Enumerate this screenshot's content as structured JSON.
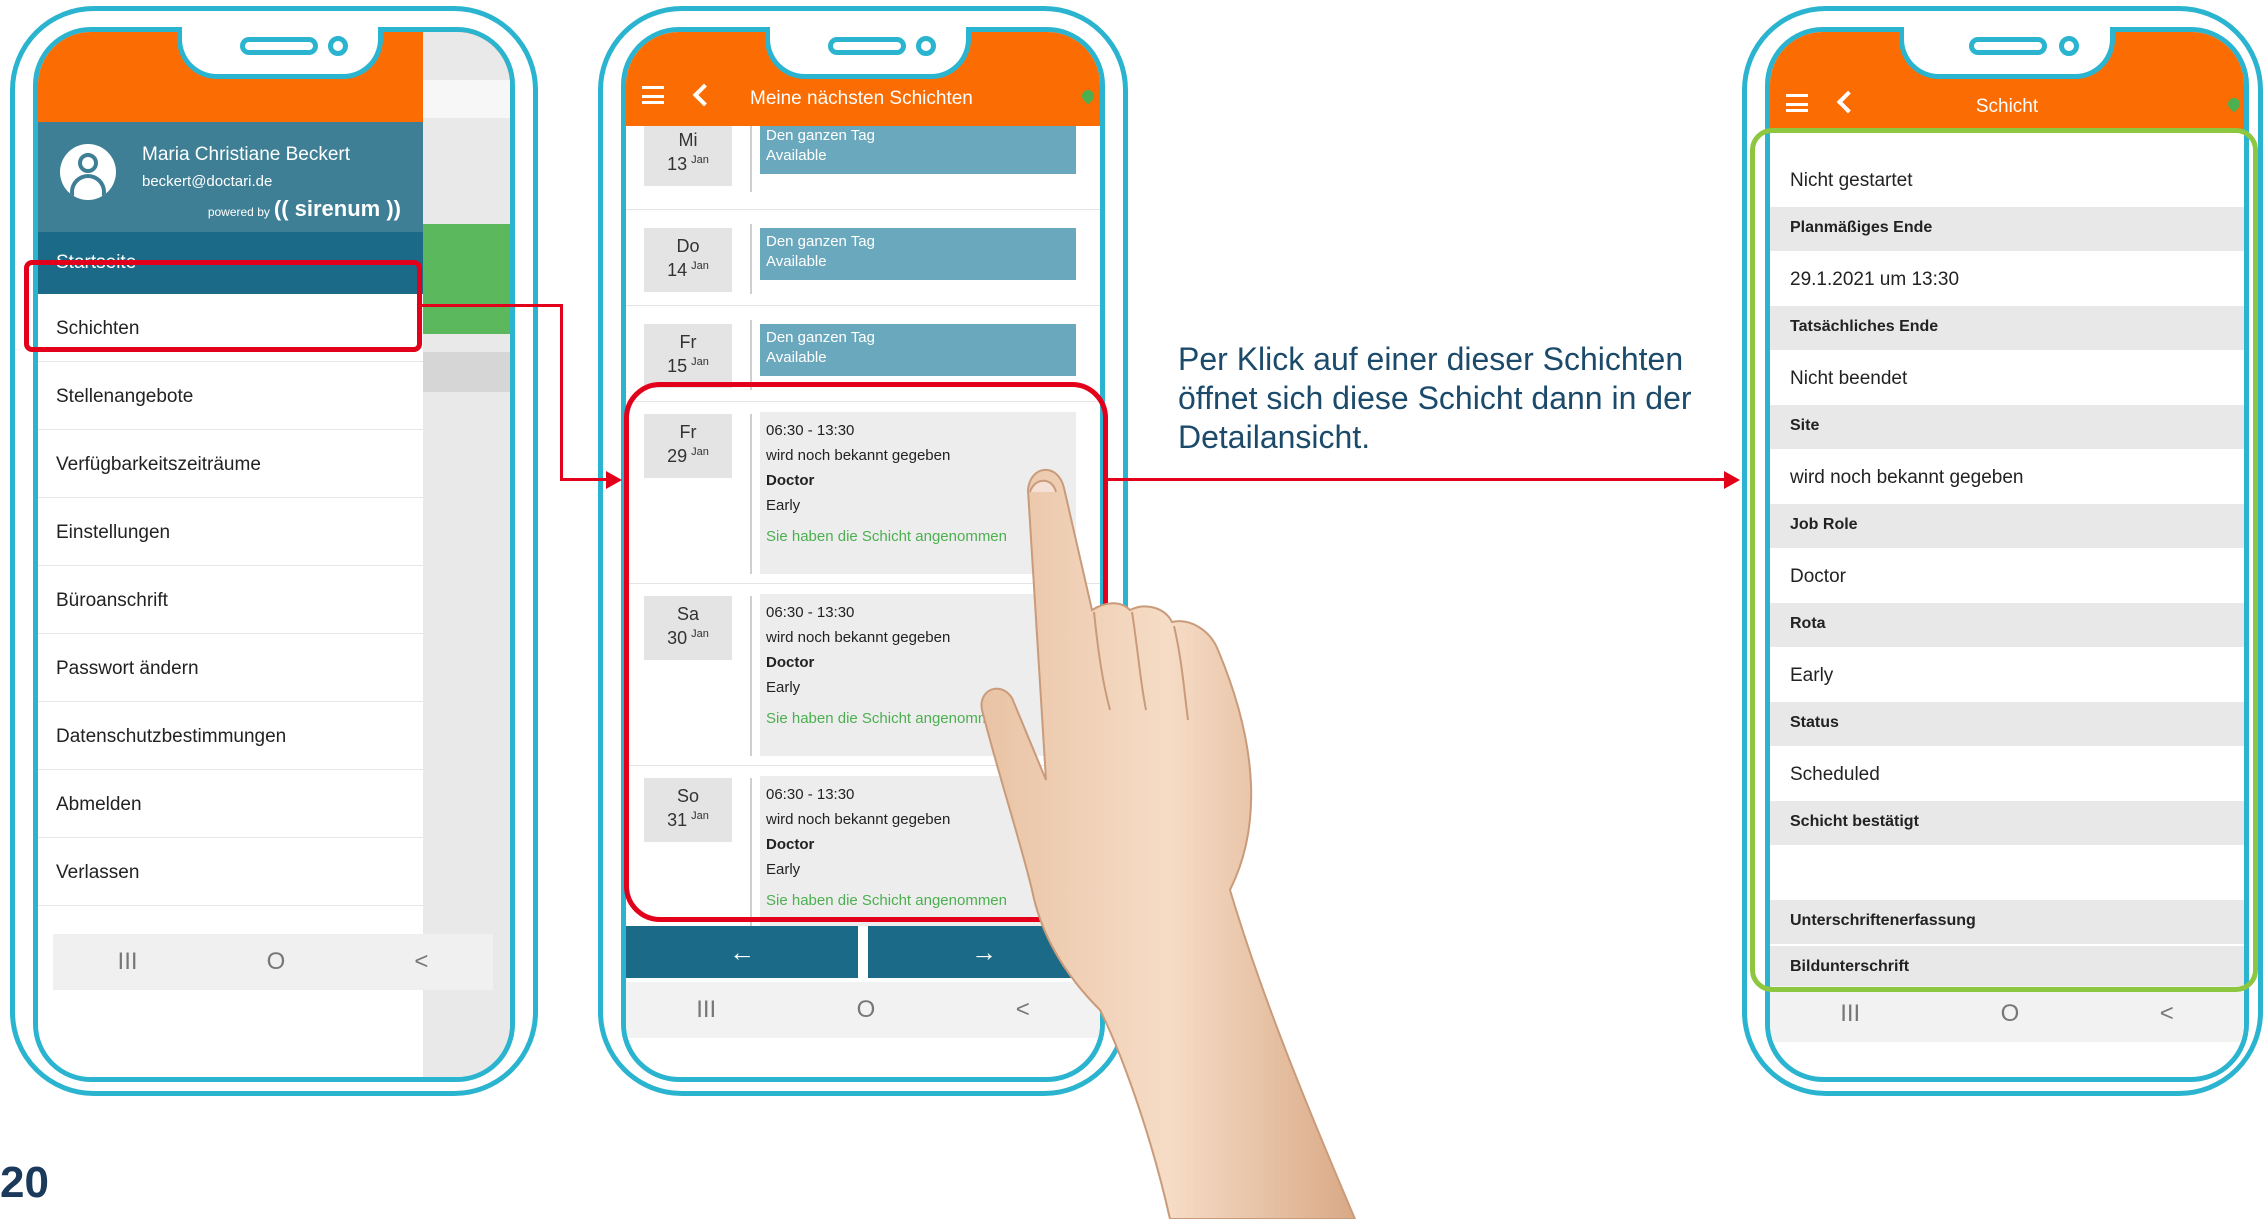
{
  "phone1": {
    "user_name": "Maria Christiane Beckert",
    "user_email": "beckert@doctari.de",
    "powered_by": "powered by",
    "brand": "(( sirenum ))",
    "active_item": "Startseite",
    "menu": [
      "Schichten",
      "Stellenangebote",
      "Verfügbarkeitszeiträume",
      "Einstellungen",
      "Büroanschrift",
      "Passwort ändern",
      "Datenschutzbestimmungen",
      "Abmelden",
      "Verlassen"
    ],
    "nav": [
      "III",
      "O",
      "<"
    ]
  },
  "phone2": {
    "title": "Meine nächsten Schichten",
    "rows": [
      {
        "day": "Mi",
        "num": "13",
        "month": "Jan",
        "line1": "Den ganzen Tag",
        "line2": "Available"
      },
      {
        "day": "Do",
        "num": "14",
        "month": "Jan",
        "line1": "Den ganzen Tag",
        "line2": "Available"
      },
      {
        "day": "Fr",
        "num": "15",
        "month": "Jan",
        "line1": "Den ganzen Tag",
        "line2": "Available"
      }
    ],
    "shifts": [
      {
        "day": "Fr",
        "num": "29",
        "month": "Jan",
        "time": "06:30 - 13:30",
        "site": "wird noch bekannt gegeben",
        "role": "Doctor",
        "rota": "Early",
        "status": "Sie haben die Schicht angenommen"
      },
      {
        "day": "Sa",
        "num": "30",
        "month": "Jan",
        "time": "06:30 - 13:30",
        "site": "wird noch bekannt gegeben",
        "role": "Doctor",
        "rota": "Early",
        "status": "Sie haben die Schicht angenommen"
      },
      {
        "day": "So",
        "num": "31",
        "month": "Jan",
        "time": "06:30 - 13:30",
        "site": "wird noch bekannt gegeben",
        "role": "Doctor",
        "rota": "Early",
        "status": "Sie haben die Schicht angenommen"
      }
    ],
    "prev_label": "←",
    "next_label": "→"
  },
  "phone3": {
    "title": "Schicht",
    "first_value": "Nicht gestartet",
    "fields": [
      {
        "label": "Planmäßiges Ende",
        "value": "29.1.2021 um 13:30"
      },
      {
        "label": "Tatsächliches Ende",
        "value": "Nicht beendet"
      },
      {
        "label": "Site",
        "value": "wird noch bekannt gegeben"
      },
      {
        "label": "Job Role",
        "value": "Doctor"
      },
      {
        "label": "Rota",
        "value": "Early"
      },
      {
        "label": "Status",
        "value": "Scheduled"
      },
      {
        "label": "Schicht bestätigt",
        "value": ""
      },
      {
        "label": "Unterschriftenerfassung",
        "value": null
      },
      {
        "label": "Bildunterschrift",
        "value": null
      }
    ]
  },
  "callout": "Per Klick auf einer dieser Schichten öffnet sich diese Schicht dann in der Detailansicht.",
  "page_number": "20",
  "colors": {
    "frame": "#2bb4cf",
    "appbar": "#fb6c02",
    "active": "#1b6a87",
    "highlight_red": "#e3001b",
    "highlight_green": "#8dc63f"
  }
}
